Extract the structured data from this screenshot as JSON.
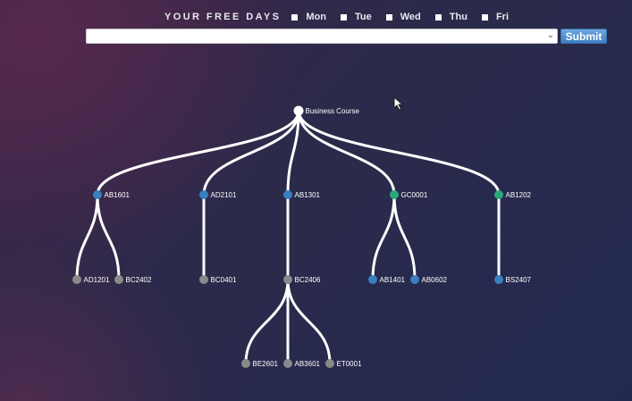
{
  "header": {
    "title": "YOUR FREE DAYS",
    "days": [
      "Mon",
      "Tue",
      "Wed",
      "Thu",
      "Fri"
    ]
  },
  "form": {
    "select_value": "",
    "submit_label": "Submit"
  },
  "tree": {
    "root": "Business Course",
    "nodes": [
      {
        "id": "root",
        "label": "Business Course",
        "color": "#ffffff"
      },
      {
        "id": "AB1601",
        "label": "AB1601",
        "color": "#3a7fc0",
        "parent": "root"
      },
      {
        "id": "AD2101",
        "label": "AD2101",
        "color": "#3a7fc0",
        "parent": "root"
      },
      {
        "id": "AB1301",
        "label": "AB1301",
        "color": "#3a7fc0",
        "parent": "root"
      },
      {
        "id": "GC0001",
        "label": "GC0001",
        "color": "#2aa87a",
        "parent": "root"
      },
      {
        "id": "AB1202",
        "label": "AB1202",
        "color": "#2aa87a",
        "parent": "root"
      },
      {
        "id": "AD1201",
        "label": "AD1201",
        "color": "#8a8a8a",
        "parent": "AB1601"
      },
      {
        "id": "BC2402",
        "label": "BC2402",
        "color": "#8a8a8a",
        "parent": "AB1601"
      },
      {
        "id": "BC0401",
        "label": "BC0401",
        "color": "#8a8a8a",
        "parent": "AD2101"
      },
      {
        "id": "BC2406",
        "label": "BC2406",
        "color": "#8a8a8a",
        "parent": "AB1301"
      },
      {
        "id": "AB1401",
        "label": "AB1401",
        "color": "#3a7fc0",
        "parent": "GC0001"
      },
      {
        "id": "AB0602",
        "label": "AB0602",
        "color": "#3a7fc0",
        "parent": "GC0001"
      },
      {
        "id": "BS2407",
        "label": "BS2407",
        "color": "#3a7fc0",
        "parent": "AB1202"
      },
      {
        "id": "BE2601",
        "label": "BE2601",
        "color": "#8a8a8a",
        "parent": "BC2406"
      },
      {
        "id": "AB3601",
        "label": "AB3601",
        "color": "#8a8a8a",
        "parent": "BC2406"
      },
      {
        "id": "ET0001",
        "label": "ET0001",
        "color": "#8a8a8a",
        "parent": "BC2406"
      }
    ]
  }
}
